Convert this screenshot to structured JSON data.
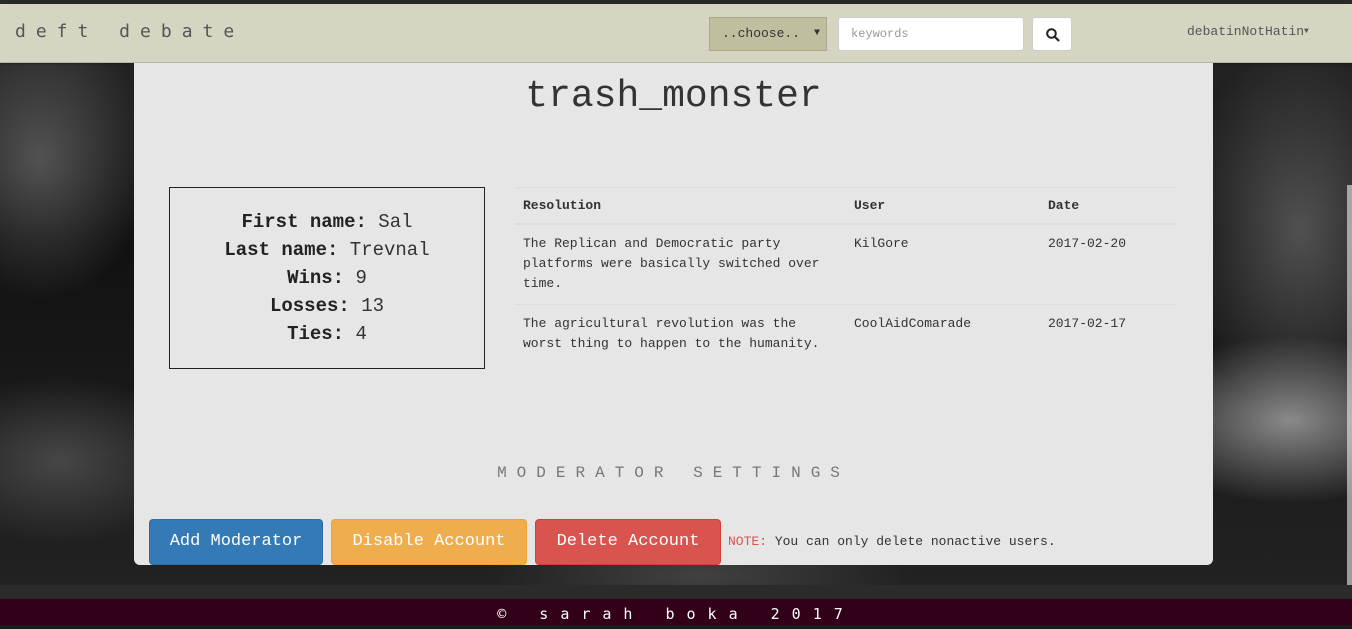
{
  "navbar": {
    "brand": "deft debate",
    "category_select": "..choose..",
    "search_placeholder": "keywords",
    "user_menu": "debatinNotHatin"
  },
  "profile": {
    "username": "trash_monster",
    "first_name_label": "First name:",
    "first_name": "Sal",
    "last_name_label": "Last name:",
    "last_name": "Trevnal",
    "wins_label": "Wins:",
    "wins": "9",
    "losses_label": "Losses:",
    "losses": "13",
    "ties_label": "Ties:",
    "ties": "4"
  },
  "debates": {
    "headers": [
      "Resolution",
      "User",
      "Date"
    ],
    "rows": [
      {
        "resolution": "The Replican and Democratic party platforms were basically switched over time.",
        "user": "KilGore",
        "date": "2017-02-20"
      },
      {
        "resolution": "The agricultural revolution was the worst thing to happen to the humanity.",
        "user": "CoolAidComarade",
        "date": "2017-02-17"
      }
    ]
  },
  "moderator": {
    "title": "MODERATOR SETTINGS",
    "add_label": "Add Moderator",
    "disable_label": "Disable Account",
    "delete_label": "Delete Account",
    "note_label": "NOTE:",
    "note_text": " You can only delete nonactive users."
  },
  "footer": {
    "text": "© sarah boka 2017"
  },
  "colors": {
    "navbar_bg": "#d6d5c2",
    "primary": "#337ab7",
    "warning": "#f0ad4e",
    "danger": "#d9534f",
    "footer_bg": "#33001a"
  }
}
